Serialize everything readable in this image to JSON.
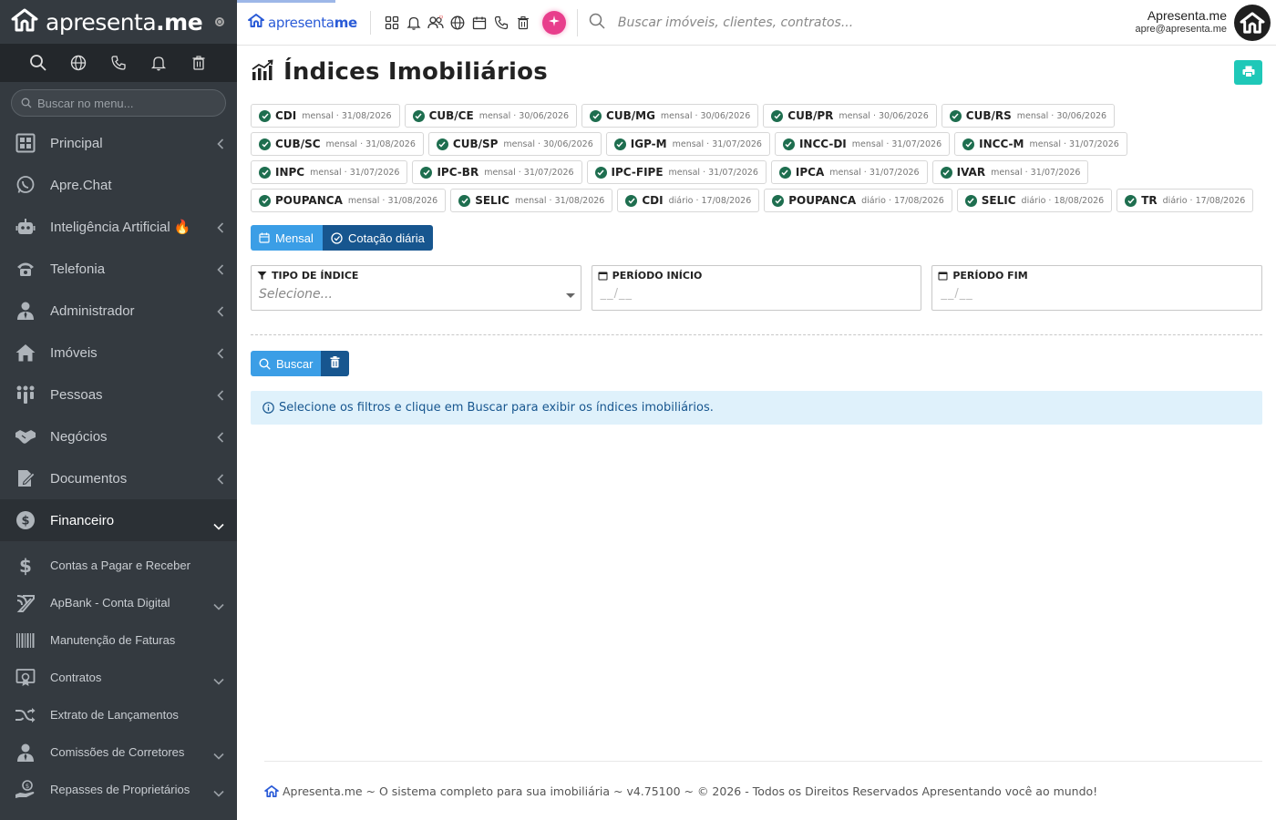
{
  "sidebar": {
    "brand": {
      "regular": "apresenta",
      "bold": ".me"
    },
    "search_placeholder": "Buscar no menu...",
    "items": [
      {
        "label": "Principal",
        "icon": "dashboard-icon",
        "chevron": "left"
      },
      {
        "label": "Apre.Chat",
        "icon": "whatsapp-icon",
        "chevron": ""
      },
      {
        "label": "Inteligência Artificial 🔥",
        "icon": "robot-icon",
        "chevron": "left"
      },
      {
        "label": "Telefonia",
        "icon": "phone-icon",
        "chevron": "left"
      },
      {
        "label": "Administrador",
        "icon": "user-tie-icon",
        "chevron": "left"
      },
      {
        "label": "Imóveis",
        "icon": "home-icon",
        "chevron": "left"
      },
      {
        "label": "Pessoas",
        "icon": "people-icon",
        "chevron": "left"
      },
      {
        "label": "Negócios",
        "icon": "handshake-icon",
        "chevron": "left"
      },
      {
        "label": "Documentos",
        "icon": "file-edit-icon",
        "chevron": "left"
      },
      {
        "label": "Financeiro",
        "icon": "dollar-circle-icon",
        "chevron": "down"
      }
    ],
    "subitems": [
      {
        "label": "Contas a Pagar e Receber",
        "icon": "dollar-icon",
        "chevron": false
      },
      {
        "label": "ApBank - Conta Digital",
        "icon": "bank-icon",
        "chevron": true
      },
      {
        "label": "Manutenção de Faturas",
        "icon": "barcode-icon",
        "chevron": false
      },
      {
        "label": "Contratos",
        "icon": "certificate-icon",
        "chevron": true
      },
      {
        "label": "Extrato de Lançamentos",
        "icon": "shuffle-icon",
        "chevron": false
      },
      {
        "label": "Comissões de Corretores",
        "icon": "user-tie-icon",
        "chevron": true
      },
      {
        "label": "Repasses de Proprietários",
        "icon": "hand-coin-icon",
        "chevron": true
      }
    ]
  },
  "topbar": {
    "brand": {
      "regular": "apresenta",
      "bold": "me"
    },
    "search_placeholder": "Buscar imóveis, clientes, contratos...",
    "user_name": "Apresenta.me",
    "user_email": "apre@apresenta.me"
  },
  "page": {
    "title": "Índices Imobiliários",
    "indices": [
      {
        "name": "CDI",
        "meta": "mensal · 31/08/2026"
      },
      {
        "name": "CUB/CE",
        "meta": "mensal · 30/06/2026"
      },
      {
        "name": "CUB/MG",
        "meta": "mensal · 30/06/2026"
      },
      {
        "name": "CUB/PR",
        "meta": "mensal · 30/06/2026"
      },
      {
        "name": "CUB/RS",
        "meta": "mensal · 30/06/2026"
      },
      {
        "name": "CUB/SC",
        "meta": "mensal · 31/08/2026"
      },
      {
        "name": "CUB/SP",
        "meta": "mensal · 30/06/2026"
      },
      {
        "name": "IGP-M",
        "meta": "mensal · 31/07/2026"
      },
      {
        "name": "INCC-DI",
        "meta": "mensal · 31/07/2026"
      },
      {
        "name": "INCC-M",
        "meta": "mensal · 31/07/2026"
      },
      {
        "name": "INPC",
        "meta": "mensal · 31/07/2026"
      },
      {
        "name": "IPC-BR",
        "meta": "mensal · 31/07/2026"
      },
      {
        "name": "IPC-FIPE",
        "meta": "mensal · 31/07/2026"
      },
      {
        "name": "IPCA",
        "meta": "mensal · 31/07/2026"
      },
      {
        "name": "IVAR",
        "meta": "mensal · 31/07/2026"
      },
      {
        "name": "POUPANCA",
        "meta": "mensal · 31/08/2026"
      },
      {
        "name": "SELIC",
        "meta": "mensal · 31/08/2026"
      },
      {
        "name": "CDI",
        "meta": "diário · 17/08/2026"
      },
      {
        "name": "POUPANCA",
        "meta": "diário · 17/08/2026"
      },
      {
        "name": "SELIC",
        "meta": "diário · 18/08/2026"
      },
      {
        "name": "TR",
        "meta": "diário · 17/08/2026"
      }
    ],
    "toggle": {
      "monthly": "Mensal",
      "daily": "Cotação diária"
    },
    "filters": {
      "type_label": "TIPO DE ÍNDICE",
      "type_placeholder": "Selecione...",
      "start_label": "PERÍODO INÍCIO",
      "start_value": "__/__",
      "end_label": "PERÍODO FIM",
      "end_value": "__/__"
    },
    "search_button": "Buscar",
    "info_message": "Selecione os filtros e clique em Buscar para exibir os índices imobiliários."
  },
  "footer": {
    "text": "Apresenta.me ~ O sistema completo para sua imobiliária ~ v4.75100 ~ © 2026 - Todos os Direitos Reservados Apresentando você ao mundo!"
  },
  "colors": {
    "sidebar_bg": "#343a40",
    "primary": "#3b9ee6",
    "primary_dark": "#17568f",
    "success_check": "#1e6e4f",
    "print_button": "#1fc8b8",
    "info_bg": "#dff1fb",
    "ai_badge": "#e83e8c"
  }
}
